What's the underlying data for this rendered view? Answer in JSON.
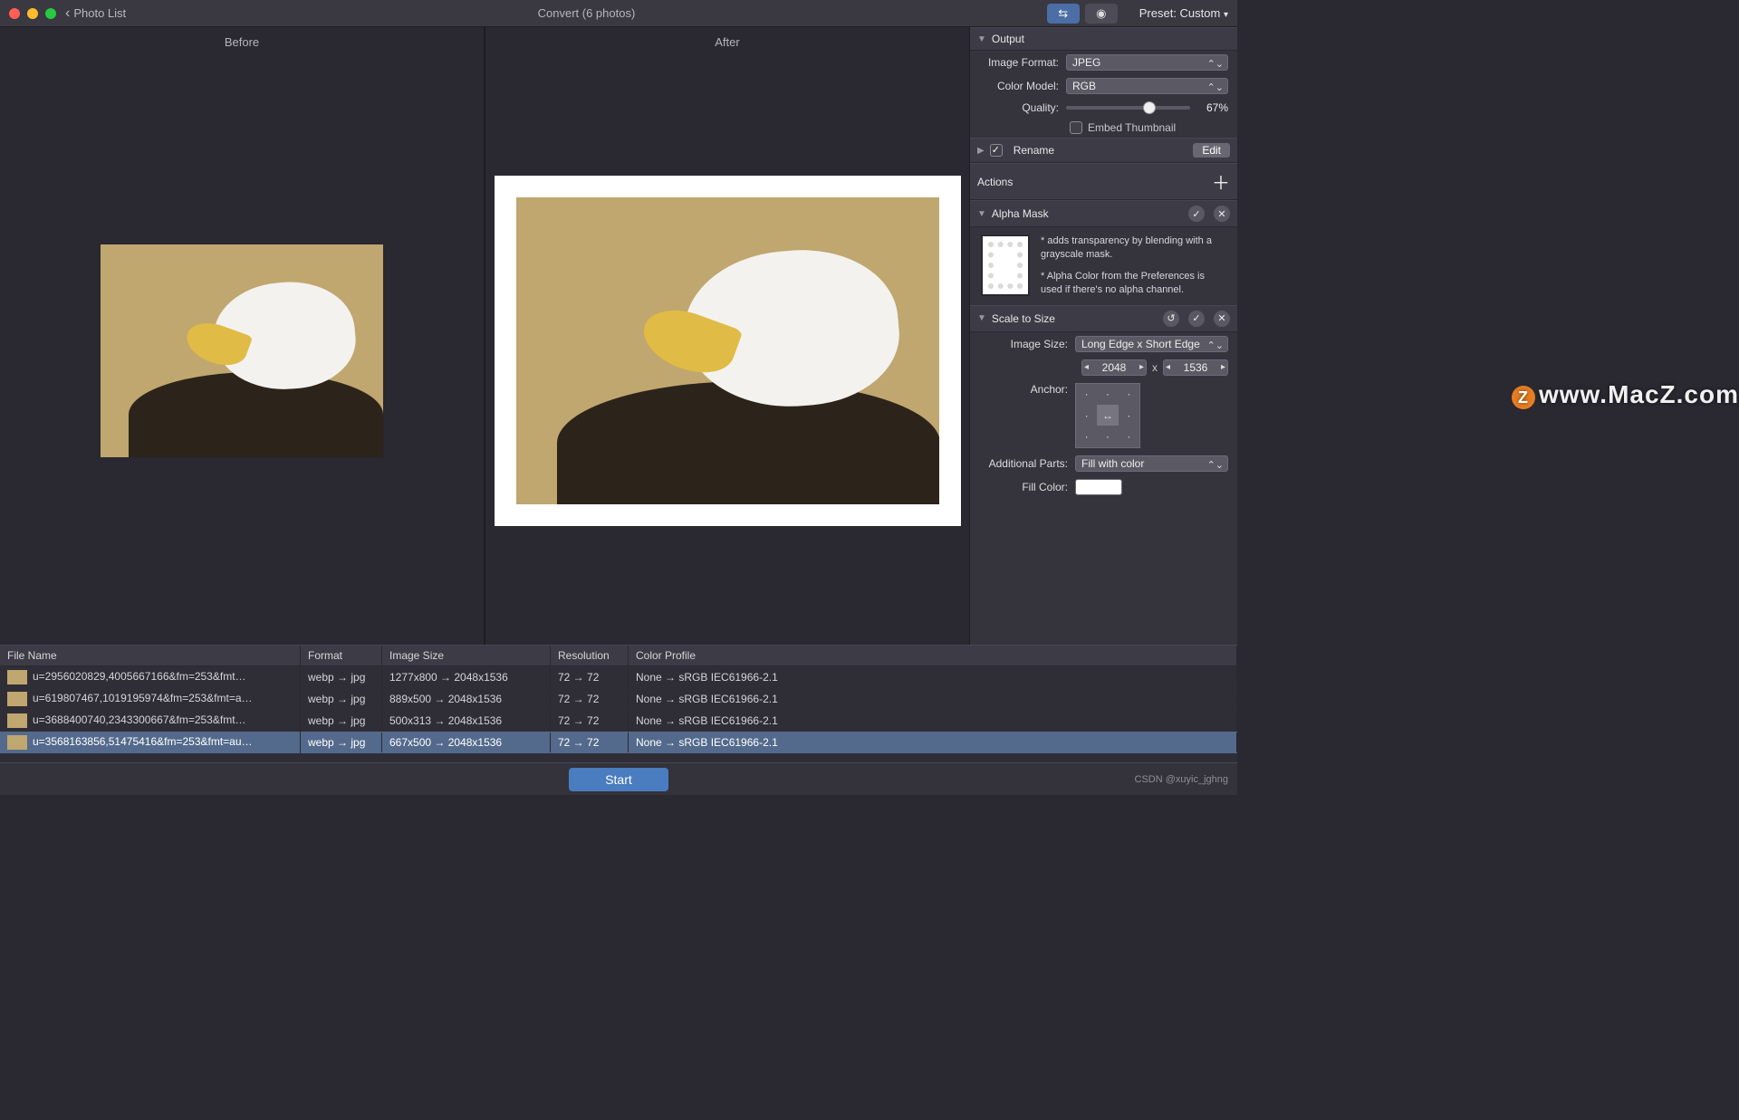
{
  "toolbar": {
    "back_label": "Photo List",
    "title": "Convert (6 photos)",
    "preset_label": "Preset: Custom"
  },
  "preview": {
    "before_label": "Before",
    "after_label": "After"
  },
  "panels": {
    "output": {
      "title": "Output",
      "image_format": {
        "label": "Image Format:",
        "value": "JPEG"
      },
      "color_model": {
        "label": "Color Model:",
        "value": "RGB"
      },
      "quality": {
        "label": "Quality:",
        "percent": "67%",
        "pct_num": 67
      },
      "embed_thumb": {
        "label": "Embed Thumbnail",
        "checked": false
      }
    },
    "rename": {
      "title": "Rename",
      "edit_label": "Edit",
      "checked": true
    },
    "actions": {
      "title": "Actions"
    },
    "alpha_mask": {
      "title": "Alpha Mask",
      "line1": "* adds transparency by blending with a grayscale mask.",
      "line2": "* Alpha Color from the Preferences is used if there's no alpha channel."
    },
    "scale": {
      "title": "Scale to Size",
      "image_size": {
        "label": "Image Size:",
        "value": "Long Edge x Short Edge"
      },
      "width": "2048",
      "height": "1536",
      "x_sep": "x",
      "anchor_label": "Anchor:",
      "additional_parts": {
        "label": "Additional Parts:",
        "value": "Fill with color"
      },
      "fill_color": {
        "label": "Fill Color:"
      }
    }
  },
  "table": {
    "headers": {
      "name": "File Name",
      "format": "Format",
      "size": "Image Size",
      "res": "Resolution",
      "profile": "Color Profile"
    },
    "rows": [
      {
        "name": "u=2956020829,4005667166&fm=253&fmt…",
        "fmt": "webp → jpg",
        "size": "1277x800 → 2048x1536",
        "res": "72 → 72",
        "profile": "None → sRGB IEC61966-2.1",
        "selected": false
      },
      {
        "name": "u=619807467,1019195974&fm=253&fmt=a…",
        "fmt": "webp → jpg",
        "size": "889x500 → 2048x1536",
        "res": "72 → 72",
        "profile": "None → sRGB IEC61966-2.1",
        "selected": false
      },
      {
        "name": "u=3688400740,2343300667&fm=253&fmt…",
        "fmt": "webp → jpg",
        "size": "500x313 → 2048x1536",
        "res": "72 → 72",
        "profile": "None → sRGB IEC61966-2.1",
        "selected": false
      },
      {
        "name": "u=3568163856,51475416&fm=253&fmt=au…",
        "fmt": "webp → jpg",
        "size": "667x500 → 2048x1536",
        "res": "72 → 72",
        "profile": "None → sRGB IEC61966-2.1",
        "selected": true
      }
    ]
  },
  "start_label": "Start",
  "watermark": "www.MacZ.com",
  "credits": "CSDN @xuyic_jghng"
}
